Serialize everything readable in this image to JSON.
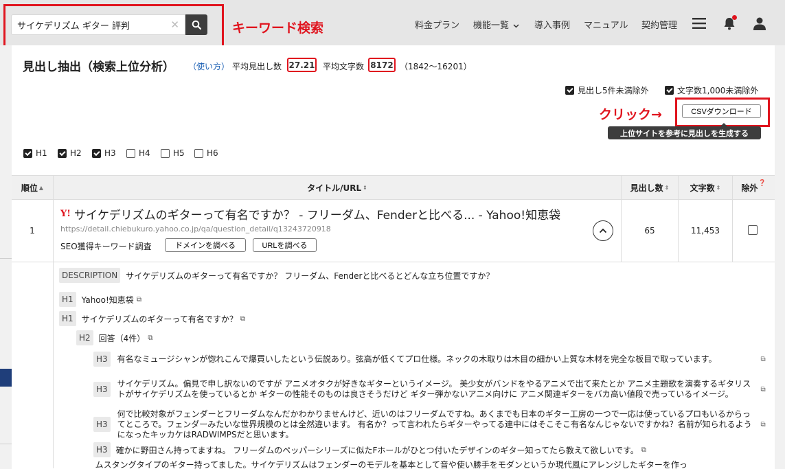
{
  "header": {
    "search_value": "サイケデリズム ギター 評判",
    "keyword_note": "キーワード検索",
    "nav": [
      "料金プラン",
      "機能一覧",
      "導入事例",
      "マニュアル",
      "契約管理"
    ]
  },
  "page": {
    "title": "見出し抽出（検索上位分析）",
    "howto": "（使い方）",
    "avg_heading_label": "平均見出し数",
    "avg_heading_value": "27.21",
    "avg_chars_label": "平均文字数",
    "avg_chars_value": "8172",
    "range": "（1842〜16201）"
  },
  "filters": {
    "exclude_under5": "見出し5件未満除外",
    "exclude_under1000": "文字数1,000未満除外",
    "levels": [
      {
        "label": "H1",
        "checked": true
      },
      {
        "label": "H2",
        "checked": true
      },
      {
        "label": "H3",
        "checked": true
      },
      {
        "label": "H4",
        "checked": false
      },
      {
        "label": "H5",
        "checked": false
      },
      {
        "label": "H6",
        "checked": false
      }
    ]
  },
  "actions": {
    "click_note": "クリック→",
    "csv_download": "CSVダウンロード",
    "tooltip": "上位サイトを参考に見出しを生成する"
  },
  "table": {
    "headers": [
      "順位",
      "タイトル/URL",
      "見出し数",
      "文字数",
      "除外"
    ],
    "row": {
      "rank": "1",
      "logo": "Y!",
      "title": "サイケデリズムのギターって有名ですか？ - フリーダム、Fenderと比べる... - Yahoo!知恵袋",
      "url": "https://detail.chiebukuro.yahoo.co.jp/qa/question_detail/q13243720918",
      "seo_label": "SEO獲得キーワード調査",
      "domain_btn": "ドメインを調べる",
      "url_btn": "URLを調べる",
      "headings": "65",
      "chars": "11,453"
    }
  },
  "detail": {
    "description_tag": "DESCRIPTION",
    "description": "サイケデリズムのギターって有名ですか？ フリーダム、Fenderと比べるとどんな立ち位置ですか？",
    "h1a": "Yahoo!知恵袋",
    "h1b": "サイケデリズムのギターって有名ですか？",
    "h2": "回答（4件）",
    "h3_1": "有名なミュージシャンが惚れこんで爆買いしたという伝説あり。弦高が低くてプロ仕様。ネックの木取りは木目の細かい上質な木材を完全な板目で取っています。",
    "h3_2": "サイケデリズム。偏見で申し訳ないのですが アニメオタクが好きなギターというイメージ。 美少女がバンドをやるアニメで出て来たとか アニメ主題歌を演奏するギタリストがサイケデリズムを使っているとか ギターの性能そのものは良さそうだけど ギター弾かないアニメ向けに アニメ関連ギターをバカ高い値段で売っているイメージ。",
    "h3_3": "何で比較対象がフェンダーとフリーダムなんだかわかりませんけど、近いのはフリーダムですね。あくまでも日本のギター工房の一つで一応は使っているプロもいるからってところで。フェンダーみたいな世界規模のとは全然違います。 有名か？って言われたらギターやってる連中にはそこそこ有名なんじゃないですかね？名前が知られるようになったキッカケはRADWIMPSだと思います。",
    "h3_4": "確かに野田さん持ってますね。 フリーダムのペッパーシリーズに似たFホールがひとつ付いたデザインのギター知ってたら教えて欲しいです。",
    "h3_5": "ムスタングタイプのギター持ってました。サイケデリズムはフェンダーのモデルを基本として音や使い勝手をモダンというか現代風にアレンジしたギターを作っ",
    "tag_h1": "H1",
    "tag_h2": "H2",
    "tag_h3": "H3"
  }
}
